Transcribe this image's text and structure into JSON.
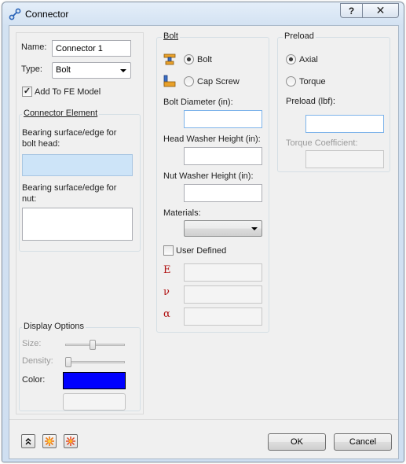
{
  "window": {
    "title": "Connector",
    "help_label": "?",
    "close_label": "✕"
  },
  "left": {
    "name_label": "Name:",
    "name_value": "Connector 1",
    "type_label": "Type:",
    "type_value": "Bolt",
    "add_fe_label": "Add To FE Model",
    "add_fe_checked": true,
    "connector_element_title": "Connector Element",
    "bearing_head_label": "Bearing surface/edge for bolt head:",
    "bearing_nut_label": "Bearing surface/edge for nut:"
  },
  "display": {
    "title": "Display Options",
    "size_label": "Size:",
    "density_label": "Density:",
    "color_label": "Color:",
    "color_value": "#0000ff",
    "size_level": 0.45,
    "density_level": 0.0
  },
  "bolt": {
    "title": "Bolt",
    "option_bolt": "Bolt",
    "option_cap_screw": "Cap Screw",
    "selected": "Bolt",
    "diameter_label": "Bolt Diameter (in):",
    "head_washer_label": "Head Washer Height (in):",
    "nut_washer_label": "Nut Washer Height (in):",
    "materials_label": "Materials:",
    "materials_value": "",
    "user_defined_label": "User Defined",
    "user_defined_checked": false,
    "sym_e": "E",
    "sym_nu": "ν",
    "sym_alpha": "α"
  },
  "preload": {
    "title": "Preload",
    "option_axial": "Axial",
    "option_torque": "Torque",
    "selected": "Axial",
    "preload_label": "Preload (lbf):",
    "torque_coeff_label": "Torque Coefficient:"
  },
  "footer": {
    "ok_label": "OK",
    "cancel_label": "Cancel"
  },
  "colors": {
    "accent": "#0000ff",
    "symbol_red": "#b01010"
  }
}
